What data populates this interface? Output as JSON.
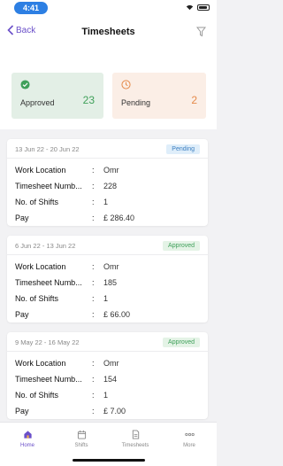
{
  "status": {
    "time": "4:41"
  },
  "header": {
    "back_label": "Back",
    "title": "Timesheets"
  },
  "summary": {
    "approved": {
      "label": "Approved",
      "value": "23"
    },
    "pending": {
      "label": "Pending",
      "value": "2"
    }
  },
  "timesheets": [
    {
      "range": "13 Jun 22 - 20 Jun 22",
      "status": "Pending",
      "rows": [
        {
          "label": "Work Location",
          "value": "Omr"
        },
        {
          "label": "Timesheet Numb...",
          "value": "228"
        },
        {
          "label": "No. of Shifts",
          "value": "1"
        },
        {
          "label": "Pay",
          "value": "£ 286.40"
        }
      ]
    },
    {
      "range": "6 Jun 22 - 13 Jun 22",
      "status": "Approved",
      "rows": [
        {
          "label": "Work Location",
          "value": "Omr"
        },
        {
          "label": "Timesheet Numb...",
          "value": "185"
        },
        {
          "label": "No. of Shifts",
          "value": "1"
        },
        {
          "label": "Pay",
          "value": "£ 66.00"
        }
      ]
    },
    {
      "range": "9 May 22 - 16 May 22",
      "status": "Approved",
      "rows": [
        {
          "label": "Work Location",
          "value": "Omr"
        },
        {
          "label": "Timesheet Numb...",
          "value": "154"
        },
        {
          "label": "No. of Shifts",
          "value": "1"
        },
        {
          "label": "Pay",
          "value": "£ 7.00"
        }
      ]
    }
  ],
  "tabs": {
    "home": "Home",
    "shifts": "Shifts",
    "timesheets": "Timesheets",
    "more": "More"
  },
  "colors": {
    "accent": "#6a4fc9",
    "approved": "#3fa05a",
    "pending": "#e58a4a"
  }
}
